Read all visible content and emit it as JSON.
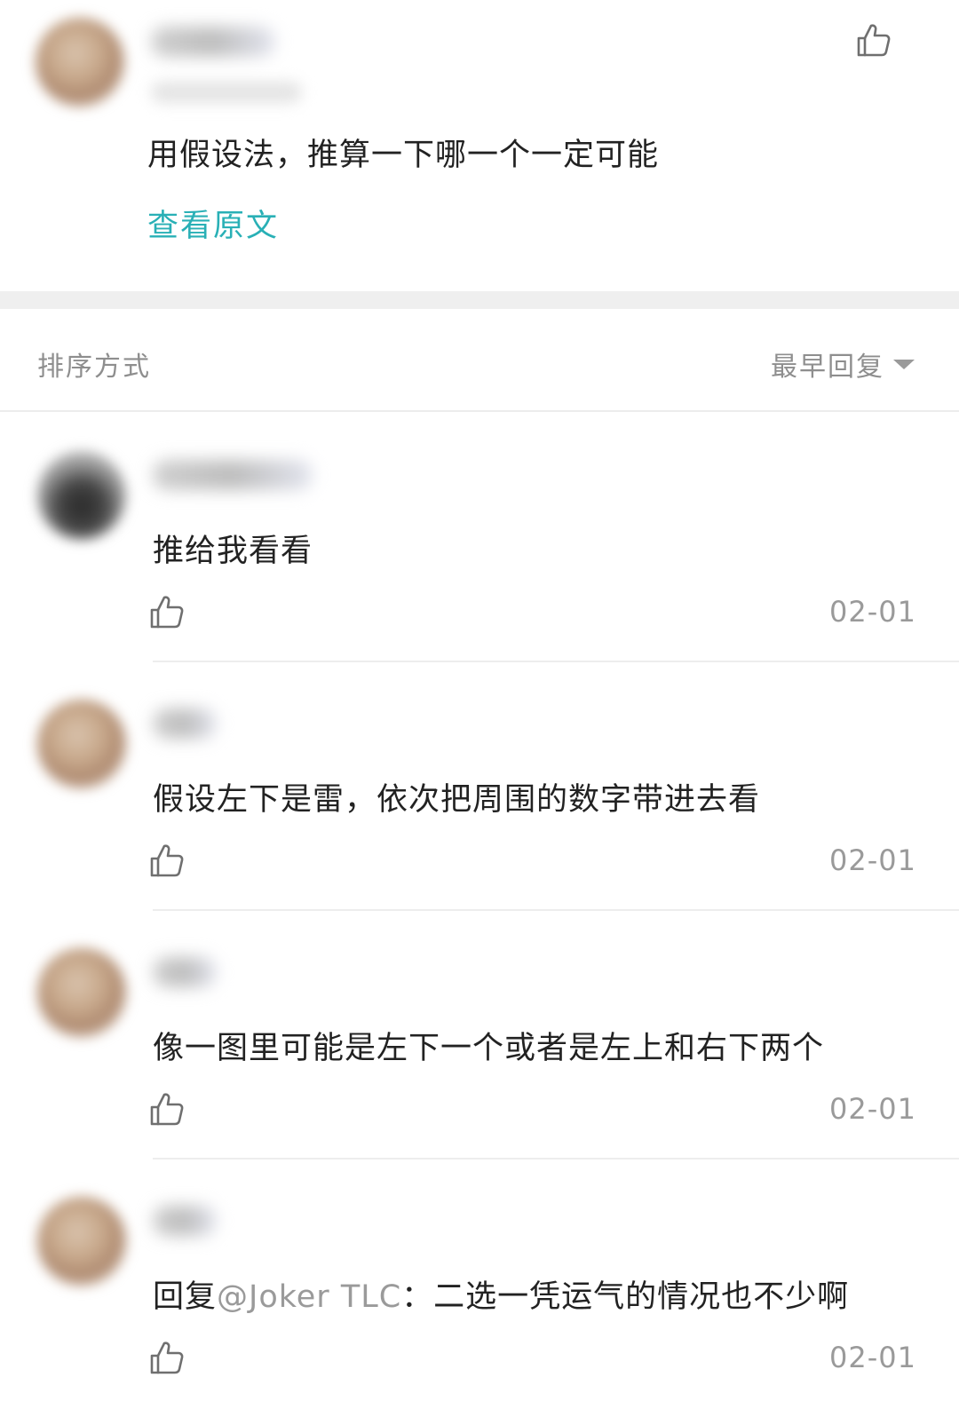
{
  "post": {
    "text": "用假设法，推算一下哪一个一定可能",
    "view_original": "查看原文",
    "like_icon": "thumbs-up-icon"
  },
  "sort": {
    "label": "排序方式",
    "value": "最早回复",
    "caret_icon": "caret-down-icon"
  },
  "comments": [
    {
      "text": "推给我看看",
      "date": "02-01",
      "like_icon": "thumbs-up-icon"
    },
    {
      "text": "假设左下是雷，依次把周围的数字带进去看",
      "date": "02-01",
      "like_icon": "thumbs-up-icon"
    },
    {
      "text": "像一图里可能是左下一个或者是左上和右下两个",
      "date": "02-01",
      "like_icon": "thumbs-up-icon"
    },
    {
      "reply_prefix": "回复",
      "mention": "@Joker TLC",
      "text": "：二选一凭运气的情况也不少啊",
      "date": "02-01",
      "like_icon": "thumbs-up-icon"
    }
  ],
  "colors": {
    "link": "#29b0b6",
    "muted": "#9a9a9a",
    "band": "#efefef"
  }
}
